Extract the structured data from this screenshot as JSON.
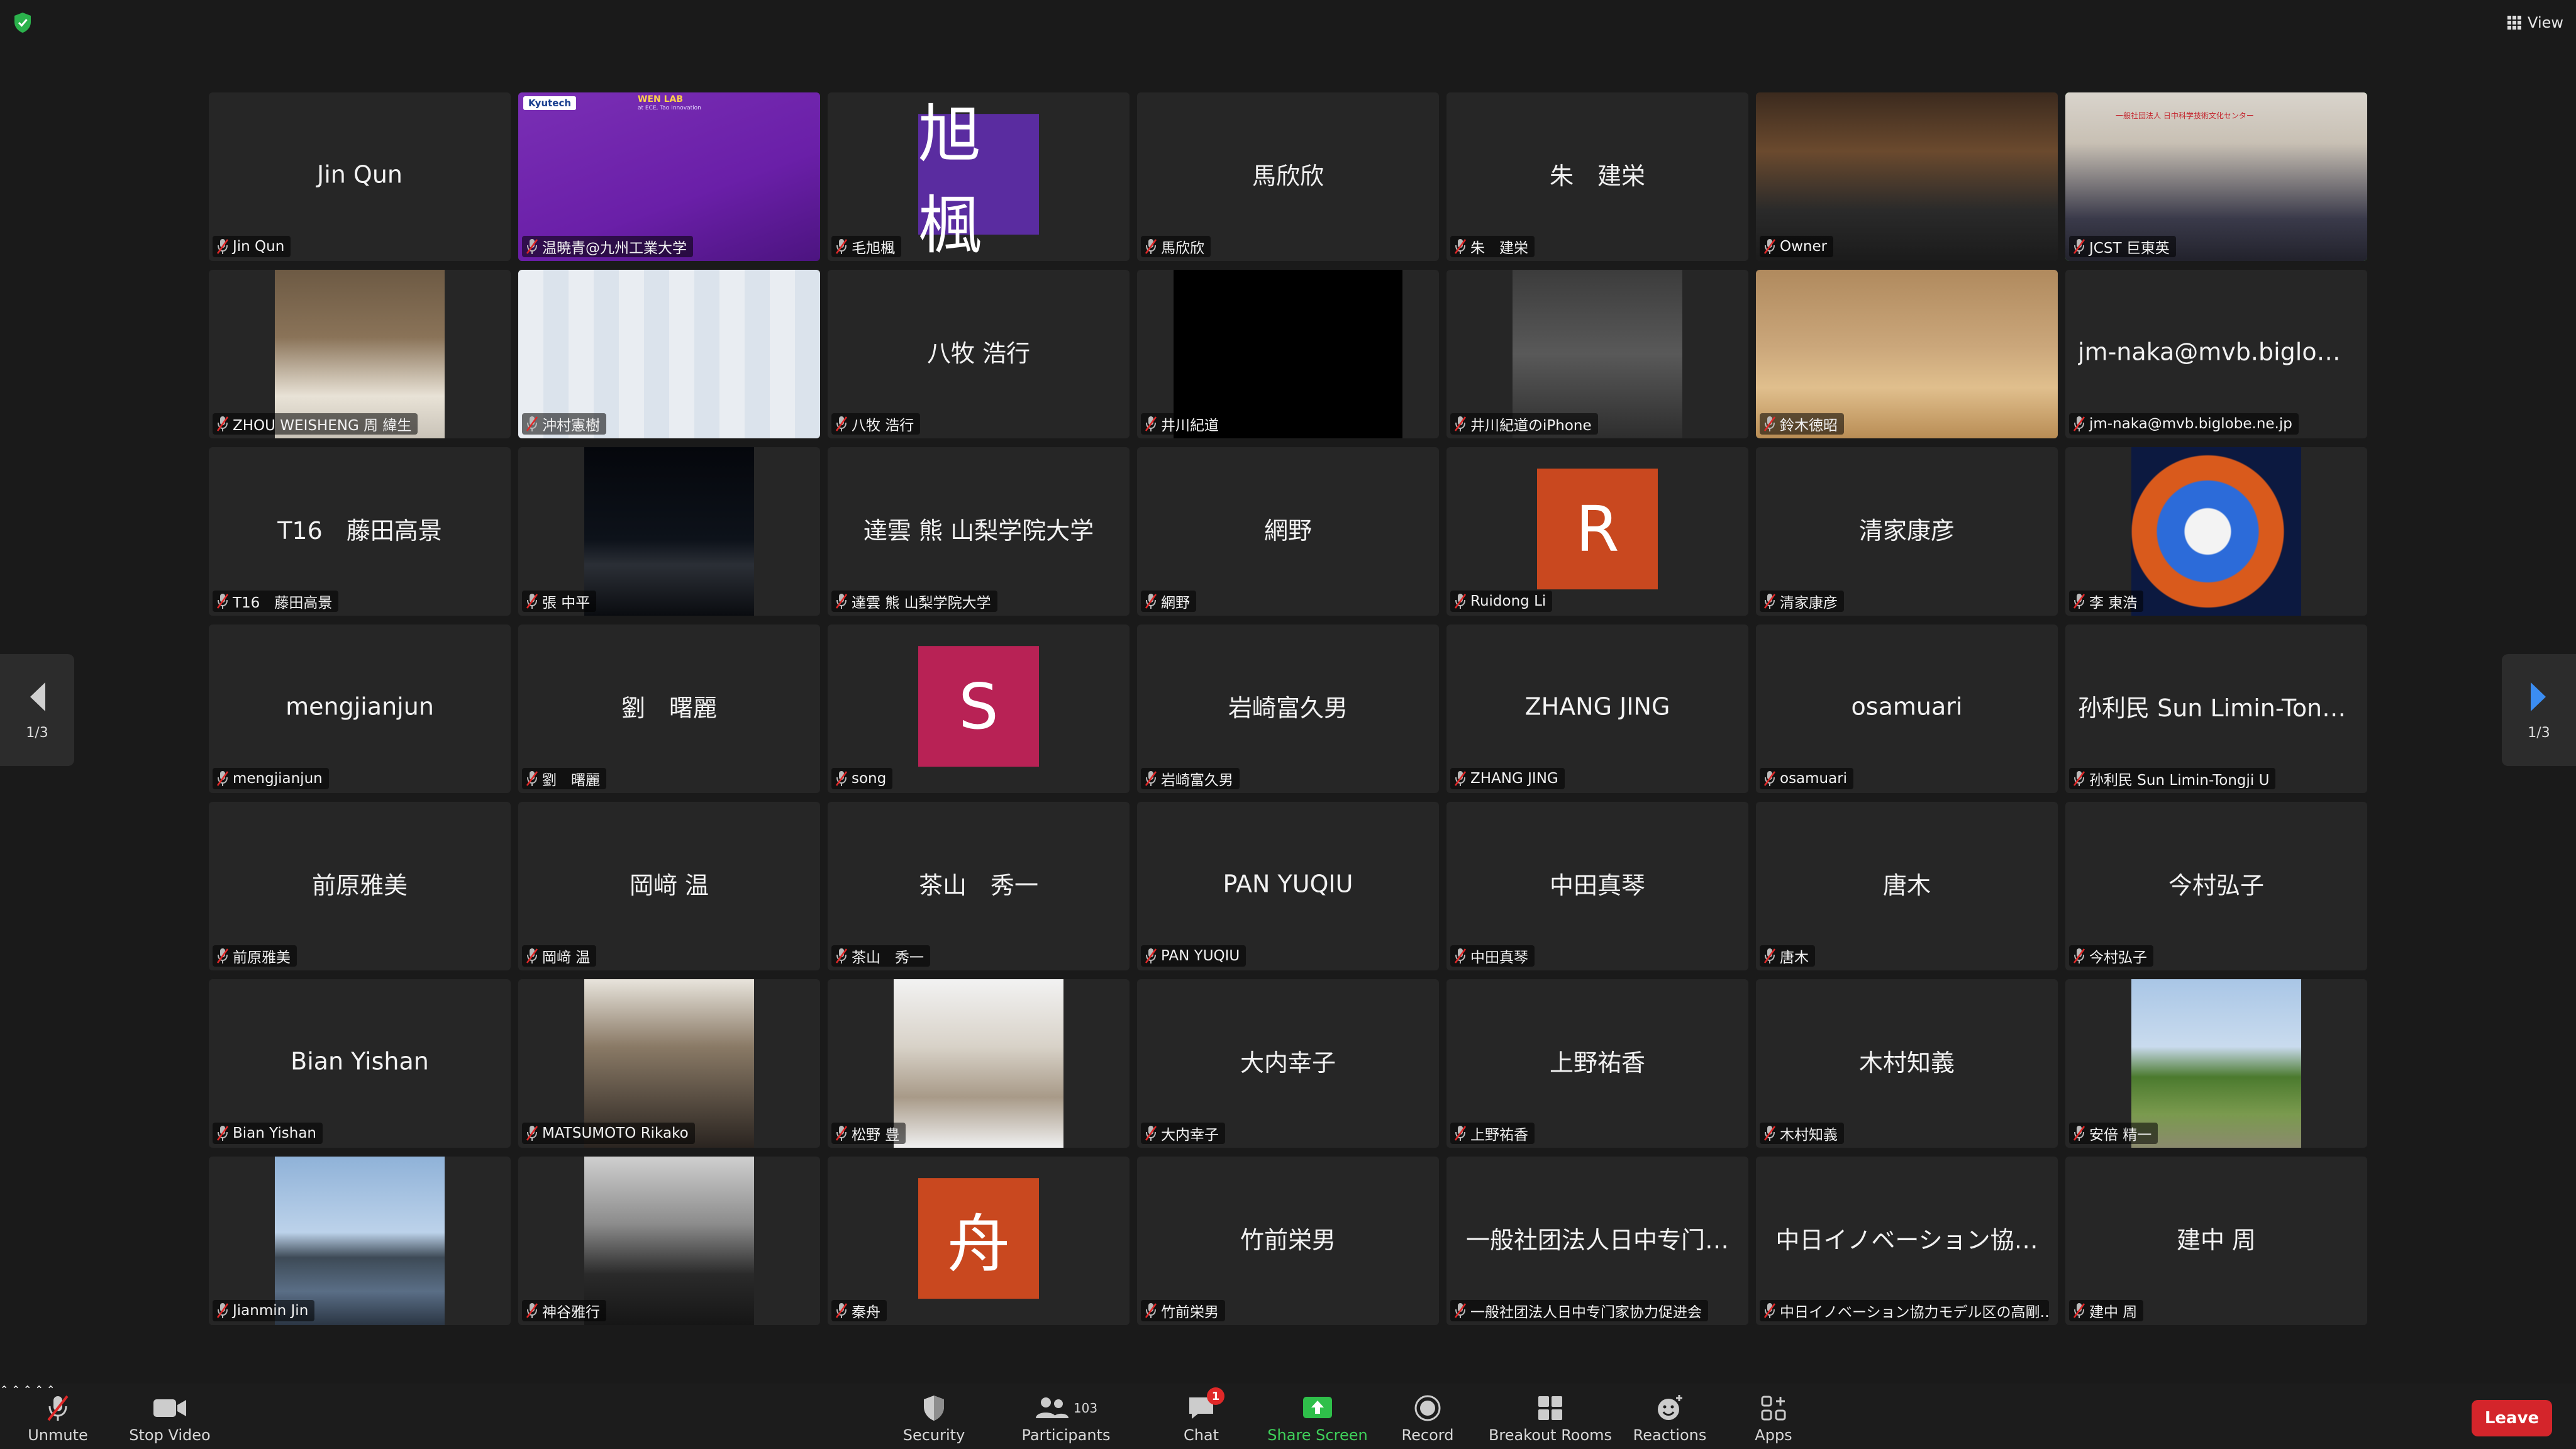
{
  "window": {
    "view_label": "View"
  },
  "pager": {
    "left_text": "1/3",
    "right_text": "1/3"
  },
  "tiles": [
    {
      "center": "Jin Qun",
      "label": "Jin Qun",
      "kind": "name"
    },
    {
      "label": "温暁青@九州工業大学",
      "kind": "video",
      "brand1": "Kyutech",
      "brand2": "WEN LAB",
      "brand3": "at ECE, Tao Innovation"
    },
    {
      "initial": "旭楓",
      "label": "毛旭楓",
      "kind": "initial",
      "color": "#5a2ca0"
    },
    {
      "center": "馬欣欣",
      "label": "馬欣欣",
      "kind": "name"
    },
    {
      "center": "朱　建栄",
      "label": "朱　建栄",
      "kind": "name"
    },
    {
      "label": "Owner",
      "kind": "video"
    },
    {
      "label": "JCST 巨東英",
      "kind": "video",
      "active": true,
      "banner": "一般社団法人 日中科学技術文化センター"
    },
    {
      "label": "ZHOU WEISHENG 周 緯生",
      "kind": "video"
    },
    {
      "label": "沖村憲樹",
      "kind": "video"
    },
    {
      "center": "八牧 浩行",
      "label": "八牧 浩行",
      "kind": "name"
    },
    {
      "label": "井川紀道",
      "kind": "black"
    },
    {
      "label": "井川紀道のiPhone",
      "kind": "video"
    },
    {
      "label": "鈴木徳昭",
      "kind": "video"
    },
    {
      "center": "jm-naka@mvb.biglobe...",
      "label": "jm-naka@mvb.biglobe.ne.jp",
      "kind": "name"
    },
    {
      "center": "T16　藤田高景",
      "label": "T16　藤田高景",
      "kind": "name"
    },
    {
      "label": "張 中平",
      "kind": "video"
    },
    {
      "center": "達雲 熊 山梨学院大学",
      "label": "達雲 熊 山梨学院大学",
      "kind": "name"
    },
    {
      "center": "網野",
      "label": "網野",
      "kind": "name"
    },
    {
      "initial": "R",
      "label": "Ruidong Li",
      "kind": "initial",
      "color": "#c9481f"
    },
    {
      "center": "清家康彦",
      "label": "清家康彦",
      "kind": "name"
    },
    {
      "label": "李 東浩",
      "kind": "video"
    },
    {
      "center": "mengjianjun",
      "label": "mengjianjun",
      "kind": "name"
    },
    {
      "center": "劉　曙麗",
      "label": "劉　曙麗",
      "kind": "name"
    },
    {
      "initial": "S",
      "label": "song",
      "kind": "initial",
      "color": "#b82255"
    },
    {
      "center": "岩崎富久男",
      "label": "岩崎富久男",
      "kind": "name"
    },
    {
      "center": "ZHANG JING",
      "label": "ZHANG JING",
      "kind": "name"
    },
    {
      "center": "osamuari",
      "label": "osamuari",
      "kind": "name"
    },
    {
      "center": "孙利民 Sun Limin-Tongj...",
      "label": "孙利民 Sun Limin-Tongji U",
      "kind": "name"
    },
    {
      "center": "前原雅美",
      "label": "前原雅美",
      "kind": "name"
    },
    {
      "center": "岡﨑 温",
      "label": "岡﨑 温",
      "kind": "name"
    },
    {
      "center": "茶山　秀一",
      "label": "茶山　秀一",
      "kind": "name"
    },
    {
      "center": "PAN YUQIU",
      "label": "PAN YUQIU",
      "kind": "name"
    },
    {
      "center": "中田真琴",
      "label": "中田真琴",
      "kind": "name"
    },
    {
      "center": "唐木",
      "label": "唐木",
      "kind": "name"
    },
    {
      "center": "今村弘子",
      "label": "今村弘子",
      "kind": "name"
    },
    {
      "center": "Bian Yishan",
      "label": "Bian Yishan",
      "kind": "name"
    },
    {
      "label": "MATSUMOTO Rikako",
      "kind": "video"
    },
    {
      "label": "松野 豊",
      "kind": "video"
    },
    {
      "center": "大内幸子",
      "label": "大内幸子",
      "kind": "name"
    },
    {
      "center": "上野祐香",
      "label": "上野祐香",
      "kind": "name"
    },
    {
      "center": "木村知義",
      "label": "木村知義",
      "kind": "name"
    },
    {
      "label": "安倍 精一",
      "kind": "video"
    },
    {
      "label": "Jianmin Jin",
      "kind": "video"
    },
    {
      "label": "神谷雅行",
      "kind": "video"
    },
    {
      "initial": "舟",
      "label": "秦舟",
      "kind": "initial",
      "color": "#c9481f"
    },
    {
      "center": "竹前栄男",
      "label": "竹前栄男",
      "kind": "name"
    },
    {
      "center": "一般社团法人日中专门…",
      "label": "一般社团法人日中专门家协力促进会",
      "kind": "name"
    },
    {
      "center": "中日イノベーション協…",
      "label": "中日イノベーション協力モデル区の高剛…",
      "kind": "name"
    },
    {
      "center": "建中 周",
      "label": "建中 周",
      "kind": "name"
    }
  ],
  "toolbar": {
    "unmute": "Unmute",
    "stop_video": "Stop Video",
    "security": "Security",
    "participants": "Participants",
    "participants_count": "103",
    "chat": "Chat",
    "chat_badge": "1",
    "share_screen": "Share Screen",
    "record": "Record",
    "breakout_rooms": "Breakout Rooms",
    "reactions": "Reactions",
    "apps": "Apps",
    "leave": "Leave"
  },
  "colors": {
    "active_speaker": "#4cd33c",
    "share_green": "#2fbf4a",
    "leave_red": "#d4252b"
  }
}
